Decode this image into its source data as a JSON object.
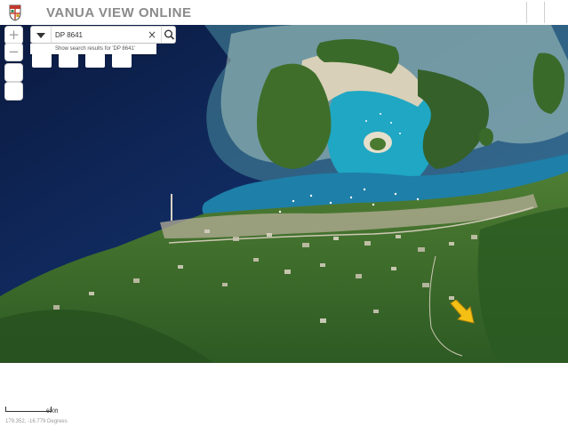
{
  "header": {
    "title": "VANUA VIEW ONLINE",
    "logo_icon": "fiji-coat-of-arms-icon"
  },
  "search": {
    "value": "DP 8641",
    "placeholder": "",
    "suggestion": "Show search results for 'DP 8641'"
  },
  "map_controls": {
    "zoom_in": "+",
    "zoom_out": "−"
  },
  "scale": {
    "label": "600ft"
  },
  "coordinates": {
    "text": "179.352, -16.779 Degrees"
  },
  "colors": {
    "ocean_deep": "#0e1f4a",
    "lagoon": "#1c9bb8",
    "land": "#3a6b2c",
    "marker": "#f5c014"
  }
}
